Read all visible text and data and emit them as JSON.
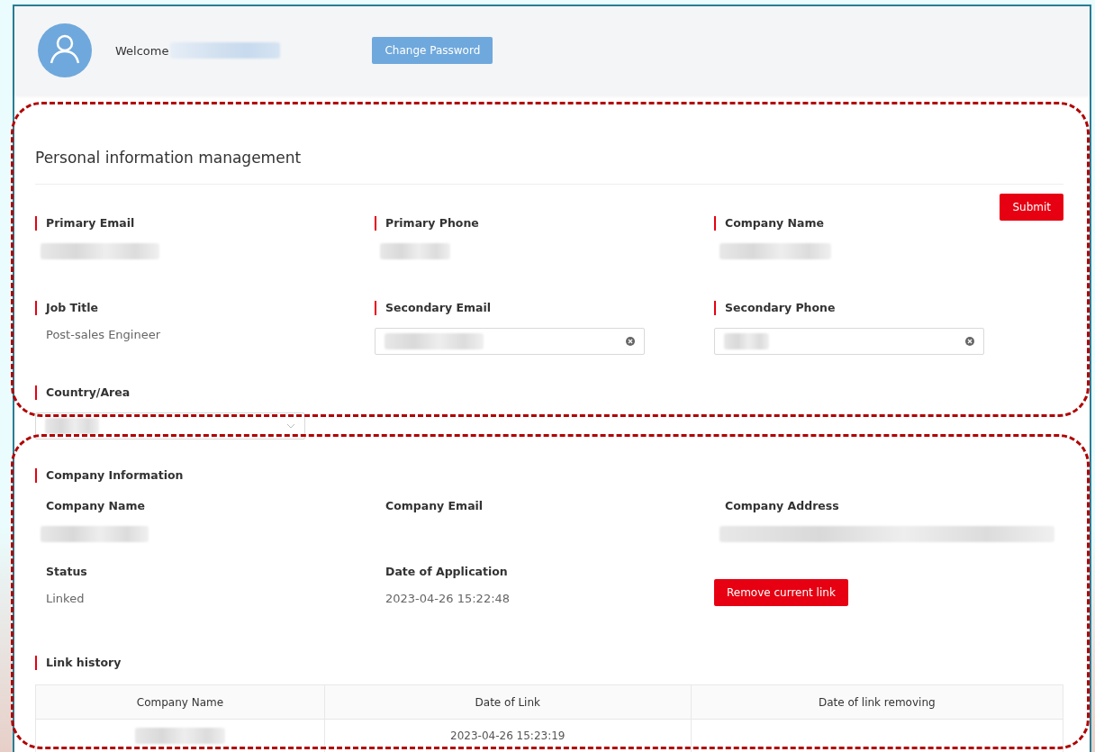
{
  "header": {
    "welcome": "Welcome",
    "change_password": "Change Password"
  },
  "personal": {
    "title": "Personal information management",
    "submit": "Submit",
    "fields": [
      {
        "label": "Primary Email",
        "kind": "redacted"
      },
      {
        "label": "Primary Phone",
        "kind": "redacted"
      },
      {
        "label": "Company Name",
        "kind": "redacted"
      },
      {
        "label": "Job Title",
        "kind": "text",
        "value": "Post-sales Engineer"
      },
      {
        "label": "Secondary Email",
        "kind": "input"
      },
      {
        "label": "Secondary Phone",
        "kind": "input"
      },
      {
        "label": "Country/Area",
        "kind": "select"
      }
    ]
  },
  "company": {
    "title": "Company Information",
    "fields": [
      {
        "label": "Company Name",
        "kind": "redacted"
      },
      {
        "label": "Company Email",
        "kind": "empty"
      },
      {
        "label": "Company Address",
        "kind": "redacted"
      },
      {
        "label": "Status",
        "kind": "text",
        "value": "Linked"
      },
      {
        "label": "Date of Application",
        "kind": "text",
        "value": "2023-04-26 15:22:48"
      },
      {
        "label": "Remove current link",
        "kind": "button"
      }
    ]
  },
  "history": {
    "title": "Link history",
    "columns": [
      "Company Name",
      "Date of Link",
      "Date of link removing"
    ],
    "rows": [
      {
        "cells": [
          {
            "kind": "redacted"
          },
          {
            "kind": "text",
            "value": "2023-04-26 15:23:19"
          },
          {
            "kind": "empty"
          }
        ]
      }
    ]
  }
}
